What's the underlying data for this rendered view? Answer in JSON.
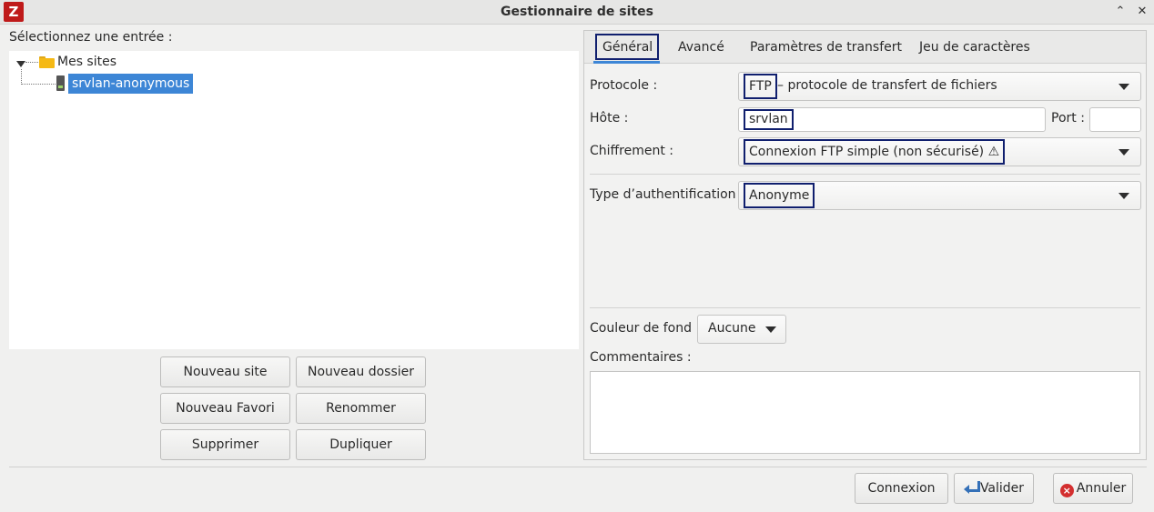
{
  "window": {
    "title": "Gestionnaire de sites",
    "app_icon_glyph": "Z",
    "collapse_glyph": "⌃",
    "close_glyph": "✕"
  },
  "left": {
    "select_label": "Sélectionnez une entrée :",
    "tree": {
      "folder_label": "Mes sites",
      "site_label": "srvlan-anonymous"
    },
    "buttons": {
      "new_site": "Nouveau site",
      "new_folder": "Nouveau dossier",
      "new_bookmark": "Nouveau Favori",
      "rename": "Renommer",
      "delete": "Supprimer",
      "duplicate": "Dupliquer"
    }
  },
  "tabs": [
    {
      "label": "Général"
    },
    {
      "label": "Avancé"
    },
    {
      "label": "Paramètres de transfert"
    },
    {
      "label": "Jeu de caractères"
    }
  ],
  "general": {
    "protocol_label": "Protocole :",
    "protocol_value_code": "FTP",
    "protocol_value_desc": "– protocole de transfert de fichiers",
    "host_label": "Hôte :",
    "host_value": "srvlan",
    "port_label": "Port :",
    "port_value": "",
    "encryption_label": "Chiffrement :",
    "encryption_value": "Connexion FTP simple (non sécurisé) ⚠",
    "auth_label": "Type d’authentification :",
    "auth_value": "Anonyme",
    "bg_color_label": "Couleur de fond :",
    "bg_color_value": "Aucune",
    "comments_label": "Commentaires :",
    "comments_value": ""
  },
  "footer": {
    "connect": "Connexion",
    "ok": "Valider",
    "cancel": "Annuler"
  },
  "colors": {
    "highlight_box": "#101f6e",
    "selection": "#3d86d6",
    "app_icon": "#bf1a1a"
  },
  "icons": [
    "filezilla-app-icon",
    "folder-icon",
    "server-icon",
    "dropdown-arrow-icon",
    "warning-icon",
    "valider-arrow-icon",
    "cancel-icon"
  ]
}
